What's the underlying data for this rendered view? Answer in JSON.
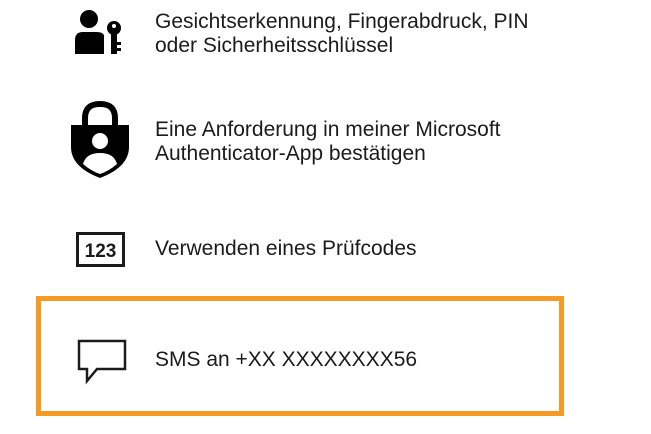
{
  "options": [
    {
      "icon": "person-key-icon",
      "label_line1": "Gesichtserkennung, Fingerabdruck, PIN",
      "label_line2": "oder Sicherheitsschlüssel"
    },
    {
      "icon": "authenticator-lock-icon",
      "label_line1": "Eine Anforderung in meiner Microsoft",
      "label_line2": "Authenticator-App bestätigen"
    },
    {
      "icon": "code-123-icon",
      "icon_text": "123",
      "label_line1": "Verwenden eines Prüfcodes"
    },
    {
      "icon": "chat-bubble-icon",
      "label_line1": "SMS an +XX XXXXXXXX56",
      "selected": true
    }
  ],
  "colors": {
    "highlight": "#f59a23",
    "text": "#1b1b1b",
    "icon": "#000000"
  }
}
